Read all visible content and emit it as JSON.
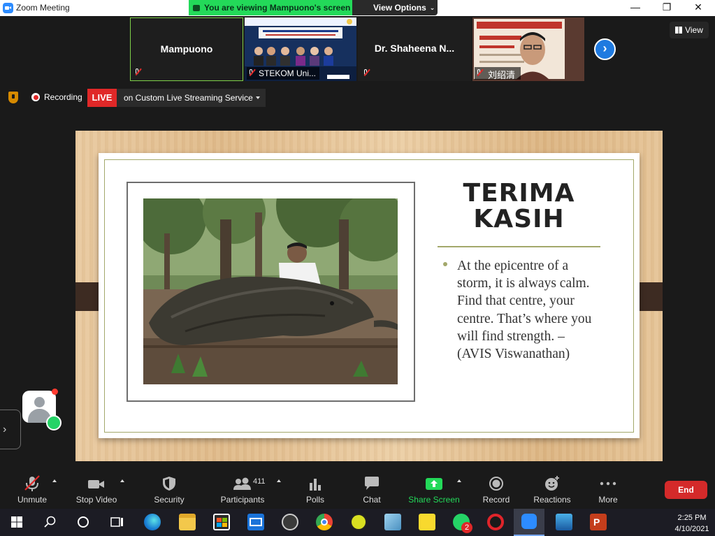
{
  "window": {
    "title": "Zoom Meeting",
    "minimize_glyph": "—",
    "restore_glyph": "❐",
    "close_glyph": "✕"
  },
  "share_banner": {
    "status": "You are viewing Mampuono's screen",
    "view_options": "View Options"
  },
  "gallery": {
    "tiles": [
      {
        "name": "Mampuono"
      },
      {
        "name": "STEKOM Uni..."
      },
      {
        "name": "Dr. Shaheena N..."
      },
      {
        "name": "刘绍清"
      }
    ],
    "view_label": "View",
    "next_glyph": "›"
  },
  "recording": {
    "label": "Recording",
    "live_badge": "LIVE",
    "service": "on Custom Live Streaming Service"
  },
  "slide": {
    "title_line1": "TERIMA",
    "title_line2": "KASIH",
    "quote_lines": [
      "At the epicentre of a",
      "storm, it is always calm.",
      "Find that centre, your",
      "centre. That’s where you",
      "will find strength. –",
      "(AVIS Viswanathan)"
    ]
  },
  "toolbar": {
    "unmute": "Unmute",
    "stop_video": "Stop Video",
    "security": "Security",
    "participants": "Participants",
    "participants_count": "411",
    "polls": "Polls",
    "chat": "Chat",
    "share_screen": "Share Screen",
    "record": "Record",
    "reactions": "Reactions",
    "more": "More",
    "end": "End"
  },
  "taskbar": {
    "time": "2:25 PM",
    "date": "4/10/2021",
    "whatsapp_badge": "2"
  },
  "colors": {
    "share_green": "#23d959",
    "live_red": "#e02828",
    "end_red": "#d42a2a",
    "zoom_blue": "#2d8cff",
    "slide_olive": "#a3a86b"
  }
}
